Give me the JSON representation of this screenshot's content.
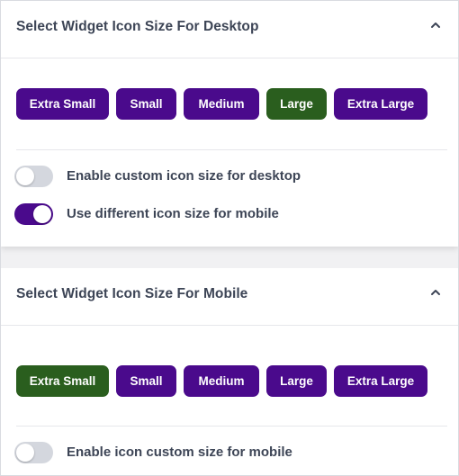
{
  "colors": {
    "primary": "#4a0a8c",
    "selected": "#2a5e1e",
    "toggle_off": "#d4d7de"
  },
  "desktop": {
    "title": "Select Widget Icon Size For Desktop",
    "collapse_icon": "chevron-up-icon",
    "sizes": [
      {
        "label": "Extra Small",
        "selected": false
      },
      {
        "label": "Small",
        "selected": false
      },
      {
        "label": "Medium",
        "selected": false
      },
      {
        "label": "Large",
        "selected": true
      },
      {
        "label": "Extra Large",
        "selected": false
      }
    ],
    "toggles": [
      {
        "label": "Enable custom icon size for desktop",
        "on": false
      },
      {
        "label": "Use different icon size for mobile",
        "on": true
      }
    ]
  },
  "mobile": {
    "title": "Select Widget Icon Size For Mobile",
    "collapse_icon": "chevron-up-icon",
    "sizes": [
      {
        "label": "Extra Small",
        "selected": true
      },
      {
        "label": "Small",
        "selected": false
      },
      {
        "label": "Medium",
        "selected": false
      },
      {
        "label": "Large",
        "selected": false
      },
      {
        "label": "Extra Large",
        "selected": false
      }
    ],
    "toggles": [
      {
        "label": "Enable icon custom size for mobile",
        "on": false
      }
    ]
  }
}
